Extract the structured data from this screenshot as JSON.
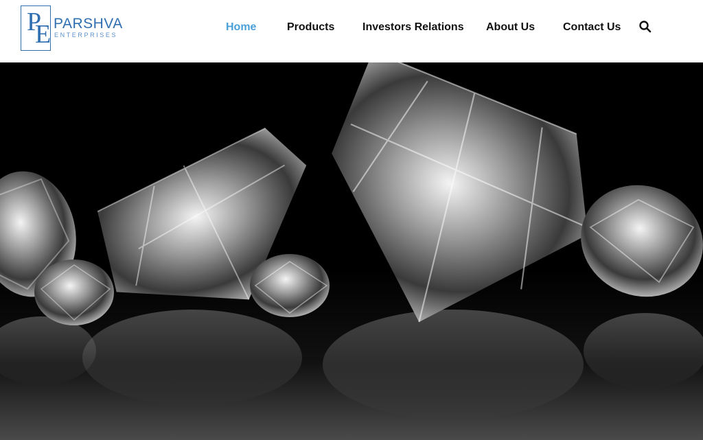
{
  "brand": {
    "initials_p": "P",
    "initials_e": "E",
    "name": "PARSHVA",
    "tagline": "ENTERPRISES",
    "color": "#2f6fb0"
  },
  "nav": {
    "items": [
      {
        "label": "Home",
        "active": true
      },
      {
        "label": "Products",
        "active": false
      },
      {
        "label": "Investors Relations",
        "active": false
      },
      {
        "label": "About Us",
        "active": false
      },
      {
        "label": "Contact Us",
        "active": false
      }
    ],
    "active_color": "#4aa0d8",
    "text_color": "#111111",
    "search_icon": "search-icon"
  },
  "hero": {
    "image": "diamonds-on-black-reflective-surface",
    "background": "#000000"
  }
}
